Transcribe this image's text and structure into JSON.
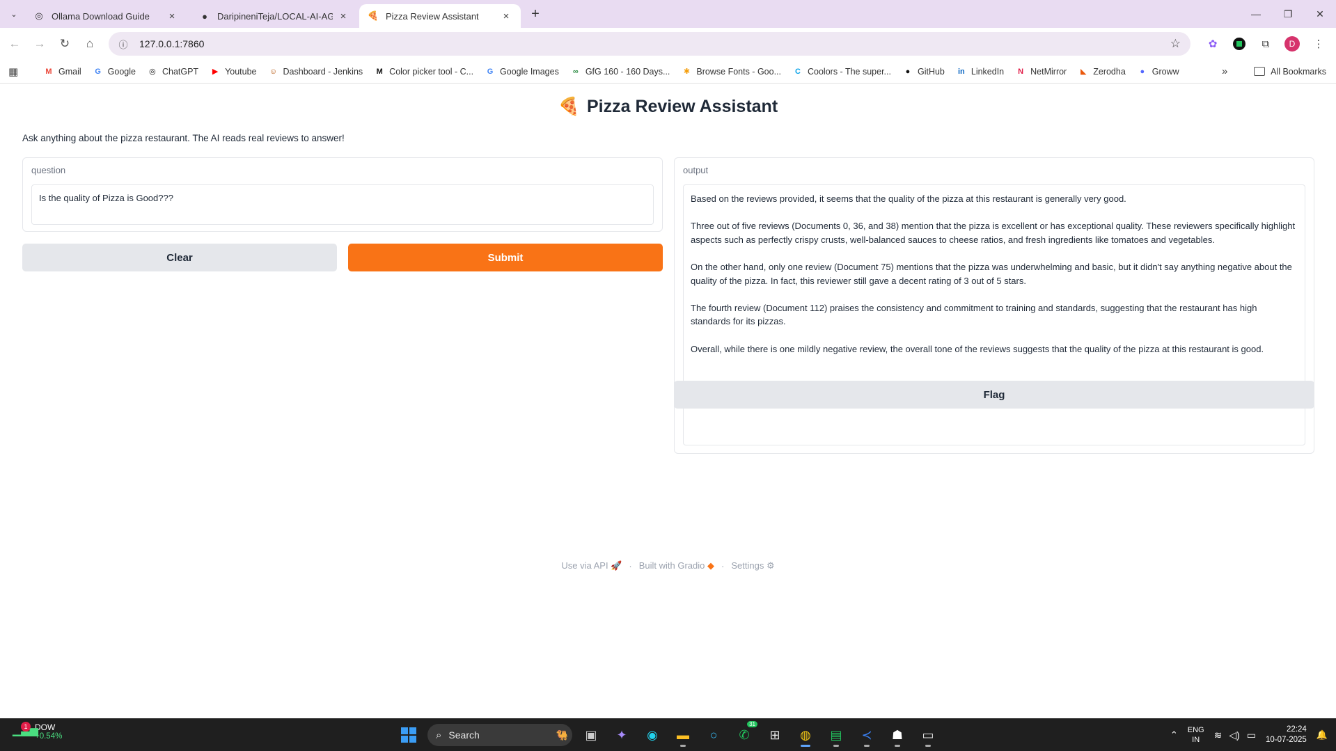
{
  "browser": {
    "tabs": [
      {
        "title": "Ollama Download Guide",
        "icon": "ollama-icon",
        "active": false
      },
      {
        "title": "DaripineniTeja/LOCAL-AI-AGEN",
        "icon": "github-icon",
        "active": false
      },
      {
        "title": "Pizza Review Assistant",
        "icon": "gradio-icon",
        "active": true
      }
    ],
    "url": "127.0.0.1:7860",
    "profile_initial": "D",
    "bookmarks": [
      {
        "label": "Gmail",
        "icon": "gmail-icon",
        "glyph": "M",
        "color": "#ea4335"
      },
      {
        "label": "Google",
        "icon": "google-icon",
        "glyph": "G",
        "color": "#4285f4"
      },
      {
        "label": "ChatGPT",
        "icon": "chatgpt-icon",
        "glyph": "◎",
        "color": "#111111"
      },
      {
        "label": "Youtube",
        "icon": "youtube-icon",
        "glyph": "▶",
        "color": "#ff0000"
      },
      {
        "label": "Dashboard - Jenkins",
        "icon": "jenkins-icon",
        "glyph": "☺",
        "color": "#b45309"
      },
      {
        "label": "Color picker tool - C...",
        "icon": "colorpicker-icon",
        "glyph": "M",
        "color": "#111111"
      },
      {
        "label": "Google Images",
        "icon": "google-icon",
        "glyph": "G",
        "color": "#4285f4"
      },
      {
        "label": "GfG 160 - 160 Days...",
        "icon": "gfg-icon",
        "glyph": "∞",
        "color": "#2f8d46"
      },
      {
        "label": "Browse Fonts - Goo...",
        "icon": "fonts-icon",
        "glyph": "✱",
        "color": "#f59e0b"
      },
      {
        "label": "Coolors - The super...",
        "icon": "coolors-icon",
        "glyph": "C",
        "color": "#0ea5e9"
      },
      {
        "label": "GitHub",
        "icon": "github-icon",
        "glyph": "●",
        "color": "#111111"
      },
      {
        "label": "LinkedIn",
        "icon": "linkedin-icon",
        "glyph": "in",
        "color": "#0a66c2"
      },
      {
        "label": "NetMirror",
        "icon": "netmirror-icon",
        "glyph": "N",
        "color": "#e11d48"
      },
      {
        "label": "Zerodha",
        "icon": "zerodha-icon",
        "glyph": "◣",
        "color": "#ea580c"
      },
      {
        "label": "Groww",
        "icon": "groww-icon",
        "glyph": "●",
        "color": "#5367ff"
      }
    ],
    "all_bookmarks": "All Bookmarks"
  },
  "app": {
    "title": "Pizza Review Assistant",
    "title_emoji": "🍕",
    "description": "Ask anything about the pizza restaurant. The AI reads real reviews to answer!",
    "question_label": "question",
    "question_value": "Is the quality of Pizza is Good???",
    "output_label": "output",
    "output_paragraphs": [
      "Based on the reviews provided, it seems that the quality of the pizza at this restaurant is generally very good.",
      "Three out of five reviews (Documents 0, 36, and 38) mention that the pizza is excellent or has exceptional quality. These reviewers specifically highlight aspects such as perfectly crispy crusts, well-balanced sauces to cheese ratios, and fresh ingredients like tomatoes and vegetables.",
      "On the other hand, only one review (Document 75) mentions that the pizza was underwhelming and basic, but it didn't say anything negative about the quality of the pizza. In fact, this reviewer still gave a decent rating of 3 out of 5 stars.",
      "The fourth review (Document 112) praises the consistency and commitment to training and standards, suggesting that the restaurant has high standards for its pizzas.",
      "Overall, while there is one mildly negative review, the overall tone of the reviews suggests that the quality of the pizza at this restaurant is good."
    ],
    "clear_label": "Clear",
    "submit_label": "Submit",
    "flag_label": "Flag",
    "footer": {
      "api": "Use via API",
      "built": "Built with Gradio",
      "settings": "Settings"
    },
    "accent_color": "#f97316"
  },
  "taskbar": {
    "widget_title": "DOW",
    "widget_change": "+0.54%",
    "widget_badge": "1",
    "search_label": "Search",
    "whatsapp_badge": "31",
    "lang_line1": "ENG",
    "lang_line2": "IN",
    "time": "22:24",
    "date": "10-07-2025"
  }
}
